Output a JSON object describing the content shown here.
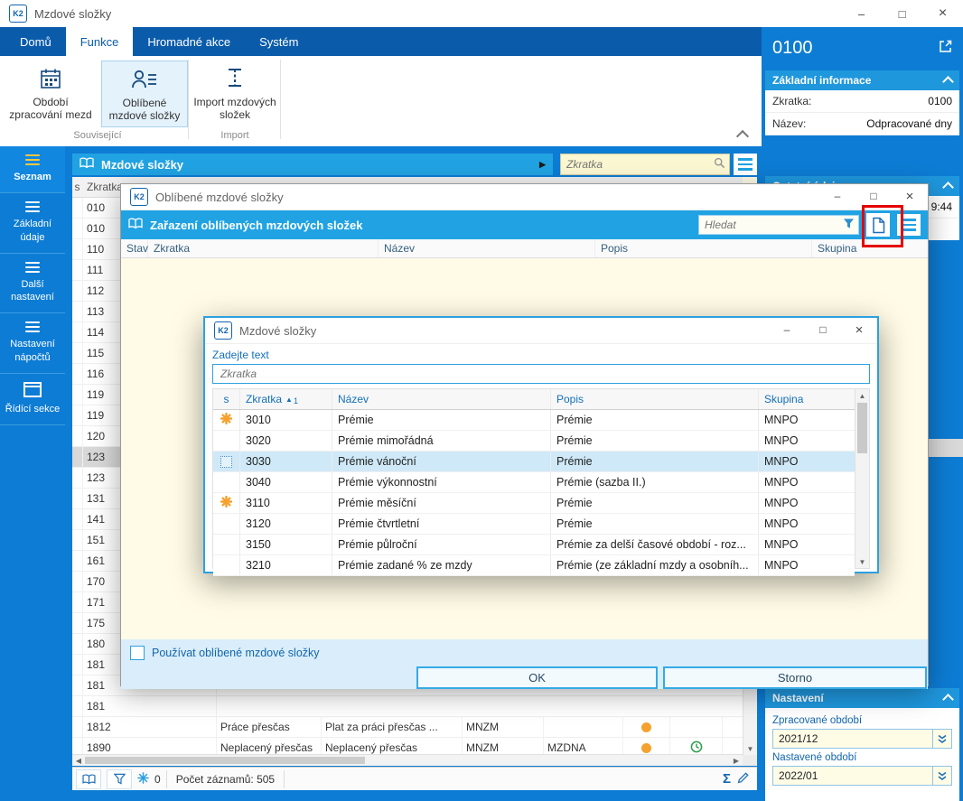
{
  "window": {
    "title": "Mzdové složky",
    "logo_text": "K2"
  },
  "ribbon": {
    "tabs": [
      {
        "label": "Domů",
        "active": false
      },
      {
        "label": "Funkce",
        "active": true
      },
      {
        "label": "Hromadné akce",
        "active": false
      },
      {
        "label": "Systém",
        "active": false
      }
    ],
    "buttons": [
      {
        "label": "Období zpracování mezd",
        "icon": "calendar-icon",
        "active": false
      },
      {
        "label": "Oblíbené mzdové složky",
        "icon": "favorites-person-icon",
        "active": true
      },
      {
        "label": "Import mzdových složek",
        "icon": "import-icon",
        "active": false
      }
    ],
    "groups": [
      {
        "label": "Související"
      },
      {
        "label": "Import"
      }
    ]
  },
  "sidebar": {
    "items": [
      {
        "label": "Seznam",
        "active": true
      },
      {
        "label": "Základní údaje",
        "active": false
      },
      {
        "label": "Další nastavení",
        "active": false
      },
      {
        "label": "Nastavení nápočtů",
        "active": false
      },
      {
        "label": "Řídící sekce",
        "active": false
      }
    ]
  },
  "main": {
    "header": {
      "title": "Mzdové složky",
      "search_placeholder": "Zkratka"
    },
    "table": {
      "columns": [
        "s",
        "Zkratka"
      ],
      "row_code_fragments": [
        "010",
        "010",
        "110",
        "111",
        "112",
        "113",
        "114",
        "115",
        "116",
        "119",
        "119",
        "120",
        "123",
        "123",
        "131",
        "141",
        "151",
        "161",
        "170",
        "171",
        "175",
        "180",
        "181",
        "181",
        "181"
      ],
      "focused_row_index": 12,
      "bottom_rows": [
        {
          "code": "1812",
          "name": "Práce přesčas",
          "desc": "Plat za práci přesčas ...",
          "group": "MNZM",
          "group2": "",
          "has_dot": true,
          "has_clock": false
        },
        {
          "code": "1890",
          "name": "Neplacený přesčas",
          "desc": "Neplacený přesčas",
          "group": "MNZM",
          "group2": "MZDNA",
          "has_dot": true,
          "has_clock": true
        }
      ]
    },
    "statusbar": {
      "badge_count": "0",
      "records_label": "Počet záznamů: 505"
    }
  },
  "right_panel": {
    "title": "0100",
    "sections": {
      "basic": {
        "title": "Základní informace",
        "fields": [
          {
            "label": "Zkratka:",
            "value": "0100"
          },
          {
            "label": "Název:",
            "value": "Odpracované dny"
          }
        ]
      },
      "other": {
        "title": "Ostatní údaje",
        "visible_value": "9:44"
      },
      "settings": {
        "title": "Nastavení",
        "fields": [
          {
            "label": "Zpracované období",
            "value": "2021/12"
          },
          {
            "label": "Nastavené období",
            "value": "2022/01"
          }
        ]
      }
    }
  },
  "dialog_favorites": {
    "title": "Oblíbené mzdové složky",
    "header_title": "Zařazení oblíbených mzdových složek",
    "search_placeholder": "Hledat",
    "columns": [
      "Stav",
      "Zkratka",
      "Název",
      "Popis",
      "Skupina"
    ],
    "checkbox_label": "Používat oblíbené mzdové složky",
    "checkbox_checked": false,
    "buttons": {
      "ok": "OK",
      "cancel": "Storno"
    }
  },
  "dialog_picker": {
    "title": "Mzdové složky",
    "prompt_label": "Zadejte text",
    "input_placeholder": "Zkratka",
    "columns": [
      "s",
      "Zkratka",
      "Název",
      "Popis",
      "Skupina"
    ],
    "sort": {
      "column": "Zkratka",
      "order": "1"
    },
    "rows": [
      {
        "fav": true,
        "code": "3010",
        "name": "Prémie",
        "desc": "Prémie",
        "group": "MNPO",
        "selected": false
      },
      {
        "fav": false,
        "code": "3020",
        "name": "Prémie mimořádná",
        "desc": "Prémie",
        "group": "MNPO",
        "selected": false
      },
      {
        "fav": false,
        "code": "3030",
        "name": "Prémie vánoční",
        "desc": "Prémie",
        "group": "MNPO",
        "selected": true
      },
      {
        "fav": false,
        "code": "3040",
        "name": "Prémie výkonnostní",
        "desc": "Prémie (sazba II.)",
        "group": "MNPO",
        "selected": false
      },
      {
        "fav": true,
        "code": "3110",
        "name": "Prémie měsíční",
        "desc": "Prémie",
        "group": "MNPO",
        "selected": false
      },
      {
        "fav": false,
        "code": "3120",
        "name": "Prémie čtvrtletní",
        "desc": "Prémie",
        "group": "MNPO",
        "selected": false
      },
      {
        "fav": false,
        "code": "3150",
        "name": "Prémie půlroční",
        "desc": "Prémie za delší časové období - roz...",
        "group": "MNPO",
        "selected": false
      },
      {
        "fav": false,
        "code": "3210",
        "name": "Prémie zadané % ze mzdy",
        "desc": "Prémie (ze základní mzdy a osobníh...",
        "group": "MNPO",
        "selected": false
      }
    ]
  },
  "colors": {
    "ribbon_blue": "#0a5cab",
    "panel_blue": "#0d7cd4",
    "header_bar_cyan": "#21a3e3",
    "favorite_orange": "#f5a12e",
    "row_highlight": "#cfe9f8",
    "annotation_red": "#e60000"
  }
}
